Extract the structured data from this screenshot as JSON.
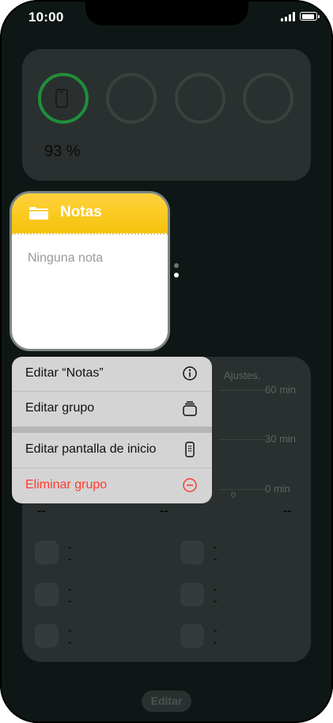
{
  "status_bar": {
    "time": "10:00"
  },
  "battery_widget": {
    "percent_label": "93 %",
    "rings": [
      "phone",
      "empty",
      "empty",
      "empty"
    ]
  },
  "notes_widget": {
    "title": "Notas",
    "empty_text": "Ninguna nota",
    "accent_color": "#f6c20b"
  },
  "screen_time_widget": {
    "header_partial": "Ajustes.",
    "y_labels": [
      "60 min",
      "30 min",
      "0 min"
    ],
    "x_label": "0",
    "summary_dashes": [
      "--",
      "--",
      "--"
    ],
    "apps": [
      {
        "name": "--",
        "time": "--"
      },
      {
        "name": "--",
        "time": "--"
      },
      {
        "name": "--",
        "time": "--"
      },
      {
        "name": "--",
        "time": "--"
      },
      {
        "name": "--",
        "time": "--"
      },
      {
        "name": "--",
        "time": "--"
      }
    ]
  },
  "context_menu": {
    "items": [
      {
        "label": "Editar “Notas”",
        "icon": "info-circle-icon"
      },
      {
        "label": "Editar grupo",
        "icon": "stack-icon"
      },
      {
        "label": "Editar pantalla de inicio",
        "icon": "phone-icon"
      },
      {
        "label": "Eliminar grupo",
        "icon": "minus-circle-icon",
        "color": "#ff3b30"
      }
    ]
  },
  "bottom": {
    "edit_label": "Editar"
  }
}
